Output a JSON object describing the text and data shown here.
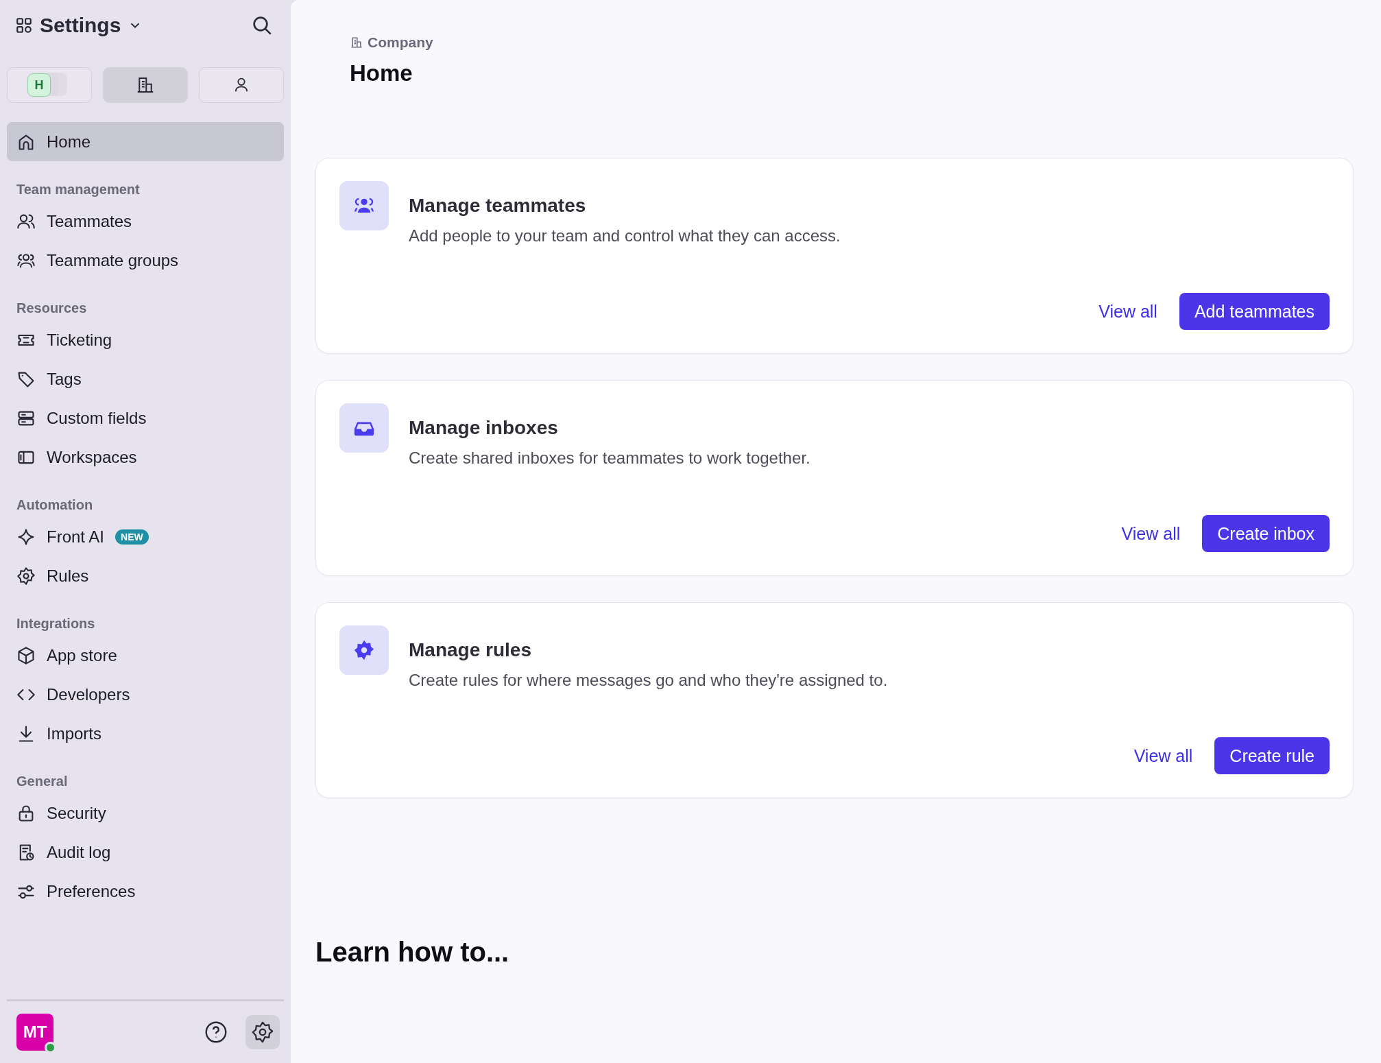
{
  "sidebar": {
    "title": "Settings",
    "scope_tabs": [
      {
        "label": "H",
        "selected": false
      },
      {
        "selected": true
      },
      {
        "selected": false
      }
    ],
    "home": {
      "label": "Home",
      "selected": true
    },
    "sections": [
      {
        "title": "Team management",
        "items": [
          {
            "label": "Teammates",
            "selected": false
          },
          {
            "label": "Teammate groups",
            "selected": false
          }
        ]
      },
      {
        "title": "Resources",
        "items": [
          {
            "label": "Ticketing",
            "selected": false
          },
          {
            "label": "Tags",
            "selected": false
          },
          {
            "label": "Custom fields",
            "selected": false
          },
          {
            "label": "Workspaces",
            "selected": false
          }
        ]
      },
      {
        "title": "Automation",
        "items": [
          {
            "label": "Front AI",
            "badge": "NEW",
            "selected": false
          },
          {
            "label": "Rules",
            "selected": false
          }
        ]
      },
      {
        "title": "Integrations",
        "items": [
          {
            "label": "App store",
            "selected": false
          },
          {
            "label": "Developers",
            "selected": false
          },
          {
            "label": "Imports",
            "selected": false
          }
        ]
      },
      {
        "title": "General",
        "items": [
          {
            "label": "Security",
            "selected": false
          },
          {
            "label": "Audit log",
            "selected": false
          },
          {
            "label": "Preferences",
            "selected": false
          }
        ]
      }
    ],
    "user": {
      "initials": "MT",
      "online": true
    }
  },
  "main": {
    "breadcrumb": "Company",
    "title": "Home",
    "cards": [
      {
        "title": "Manage teammates",
        "description": "Add people to your team and control what they can access.",
        "link": "View all",
        "button": "Add teammates"
      },
      {
        "title": "Manage inboxes",
        "description": "Create shared inboxes for teammates to work together.",
        "link": "View all",
        "button": "Create inbox"
      },
      {
        "title": "Manage rules",
        "description": "Create rules for where messages go and who they're assigned to.",
        "link": "View all",
        "button": "Create rule"
      }
    ],
    "learn_heading": "Learn how to..."
  }
}
